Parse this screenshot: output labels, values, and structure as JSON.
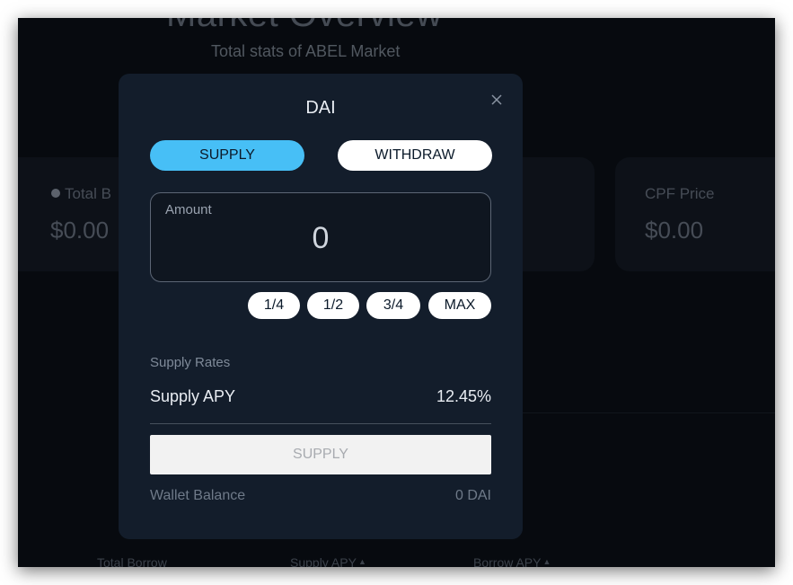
{
  "background": {
    "title": "Market Overview",
    "subtitle": "Total stats of ABEL Market",
    "cards": [
      {
        "label": "Total B",
        "value": "$0.00"
      },
      {
        "label": "",
        "value": ""
      },
      {
        "label": "CPF Price",
        "value": "$0.00"
      }
    ],
    "table_headers": [
      "Total Borrow",
      "Supply APY",
      "Borrow APY"
    ],
    "sort_icon": "arrow-up-icon"
  },
  "modal": {
    "title": "DAI",
    "close_icon": "close-icon",
    "tabs": {
      "supply": "SUPPLY",
      "withdraw": "WITHDRAW",
      "active": "supply"
    },
    "amount": {
      "label": "Amount",
      "value": "0"
    },
    "fractions": [
      "1/4",
      "1/2",
      "3/4",
      "MAX"
    ],
    "rates": {
      "title": "Supply Rates",
      "apy_label": "Supply APY",
      "apy_value": "12.45%"
    },
    "submit_label": "SUPPLY",
    "wallet": {
      "label": "Wallet Balance",
      "value": "0 DAI"
    }
  },
  "colors": {
    "accent": "#47bff6",
    "modal_bg": "#131d2b",
    "page_bg": "#0b1017"
  }
}
